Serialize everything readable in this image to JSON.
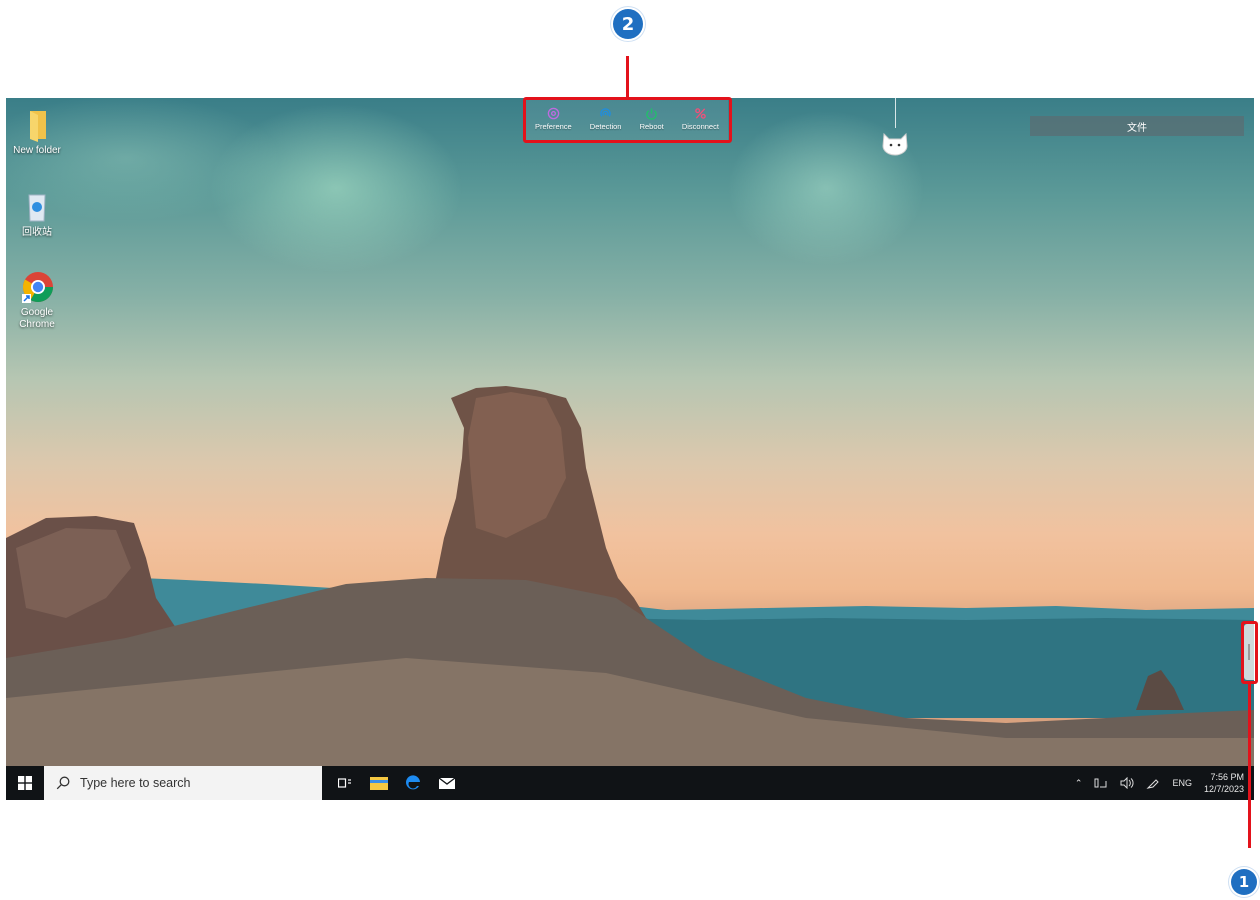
{
  "callouts": {
    "toolbar_number": "2",
    "handle_number": "1",
    "accent": "#e3121b",
    "badge_color": "#1f6fc1"
  },
  "desktop": {
    "icons": [
      {
        "label": "New folder",
        "icon": "folder-icon"
      },
      {
        "label": "回收站",
        "icon": "recycle-bin-icon"
      },
      {
        "label": "Google Chrome",
        "icon": "chrome-icon"
      }
    ]
  },
  "remote_toolbar": {
    "buttons": [
      {
        "label": "Preference",
        "icon": "preference-icon",
        "color": "#c06be0"
      },
      {
        "label": "Detection",
        "icon": "detection-icon",
        "color": "#1f8de0"
      },
      {
        "label": "Reboot",
        "icon": "reboot-icon",
        "color": "#21c06a"
      },
      {
        "label": "Disconnect",
        "icon": "disconnect-icon",
        "color": "#f0507a"
      }
    ]
  },
  "file_panel": {
    "label": "文件"
  },
  "taskbar": {
    "search_placeholder": "Type here to search",
    "tray": {
      "language": "ENG",
      "time": "7:56 PM",
      "date": "12/7/2023"
    }
  }
}
